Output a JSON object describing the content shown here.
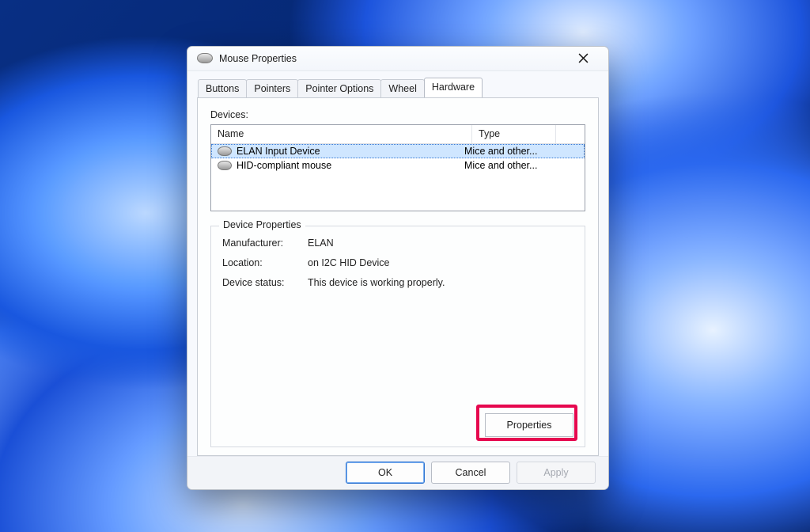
{
  "window": {
    "title": "Mouse Properties"
  },
  "tabs": [
    {
      "label": "Buttons",
      "active": false
    },
    {
      "label": "Pointers",
      "active": false
    },
    {
      "label": "Pointer Options",
      "active": false
    },
    {
      "label": "Wheel",
      "active": false
    },
    {
      "label": "Hardware",
      "active": true
    }
  ],
  "labels": {
    "devices": "Devices:",
    "col_name": "Name",
    "col_type": "Type",
    "group_legend": "Device Properties",
    "manufacturer": "Manufacturer:",
    "location": "Location:",
    "status": "Device status:",
    "properties_btn": "Properties"
  },
  "devices": [
    {
      "name": "ELAN Input Device",
      "type": "Mice and other...",
      "selected": true
    },
    {
      "name": "HID-compliant mouse",
      "type": "Mice and other...",
      "selected": false
    }
  ],
  "device_props": {
    "manufacturer": "ELAN",
    "location": "on I2C HID Device",
    "status": "This device is working properly."
  },
  "footer": {
    "ok": "OK",
    "cancel": "Cancel",
    "apply": "Apply"
  }
}
